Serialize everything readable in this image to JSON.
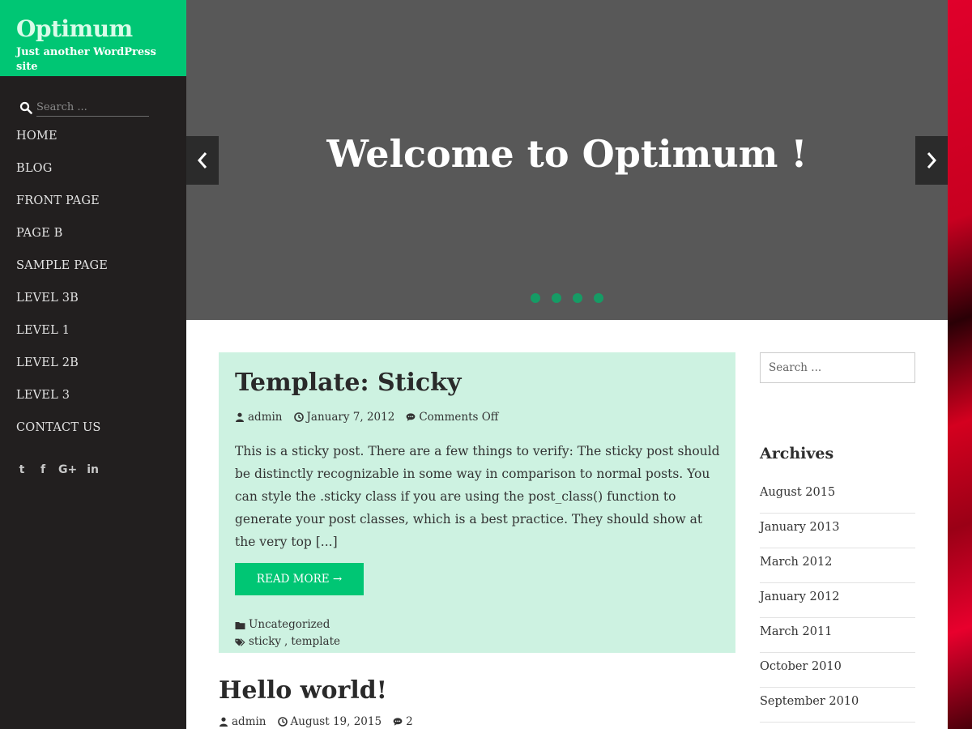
{
  "brand": {
    "title": "Optimum",
    "tagline": "Just another WordPress site"
  },
  "sidebar": {
    "search_placeholder": "Search ...",
    "nav": [
      "HOME",
      "BLOG",
      "FRONT PAGE",
      "PAGE B",
      "SAMPLE PAGE",
      "LEVEL 3B",
      "LEVEL 1",
      "LEVEL 2B",
      "LEVEL 3",
      "CONTACT US"
    ],
    "social": [
      {
        "icon": "twitter-icon",
        "glyph": "t"
      },
      {
        "icon": "facebook-icon",
        "glyph": "f"
      },
      {
        "icon": "google-plus-icon",
        "glyph": "G+"
      },
      {
        "icon": "linkedin-icon",
        "glyph": "in"
      }
    ]
  },
  "hero": {
    "title": "Welcome to Optimum !",
    "dot_count": 4
  },
  "sticky_post": {
    "title": "Template: Sticky",
    "author": "admin",
    "date": "January 7, 2012",
    "comments": "Comments Off",
    "excerpt": "This is a sticky post. There are a few things to verify: The sticky post should be distinctly recognizable in some way in comparison to normal posts. You can style the .sticky class if you are using the post_class() function to generate your post classes, which is a best practice. They should show at the very top [...]",
    "read_more": "READ MORE →",
    "category": "Uncategorized",
    "tags": [
      "sticky",
      "template"
    ],
    "tag_separator": ", "
  },
  "post2": {
    "title": "Hello world!",
    "author": "admin",
    "date": "August 19, 2015",
    "comments": "2"
  },
  "widgets": {
    "search_placeholder": "Search ...",
    "archives_title": "Archives",
    "archives": [
      "August 2015",
      "January 2013",
      "March 2012",
      "January 2012",
      "March 2011",
      "October 2010",
      "September 2010"
    ]
  },
  "colors": {
    "brand_green": "#00c674",
    "sidebar_bg": "#221f1f",
    "hero_bg": "#585858",
    "sticky_bg": "#cdf2e1",
    "dot_green": "#169b65"
  }
}
